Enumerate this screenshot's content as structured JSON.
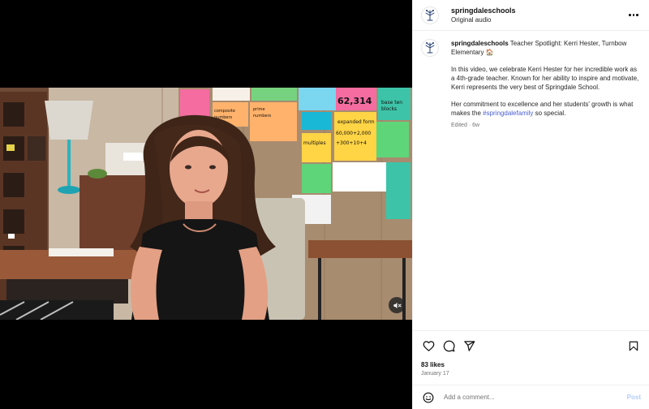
{
  "post": {
    "username": "springdaleschools",
    "audio": "Original audio",
    "caption_title": "Teacher Spotlight: Kerri Hester, Turnbow Elementary 🏠",
    "caption_p1": "In this video, we celebrate Kerri Hester for her incredible work as a 4th-grade teacher. Known for her ability to inspire and motivate, Kerri represents the very best of Springdale School.",
    "caption_p2_before": "Her commitment to excellence and her students' growth is what makes the ",
    "hashtag": "#springdalefamily",
    "caption_p2_after": " so special.",
    "edited": "Edited · 6w",
    "likes": "83 likes",
    "date": "January 17"
  },
  "comment": {
    "placeholder": "Add a comment...",
    "post_label": "Post"
  },
  "icons": {
    "more": "more-options-icon",
    "mute": "speaker-muted-icon",
    "like": "heart-icon",
    "comment": "comment-icon",
    "share": "share-icon",
    "save": "bookmark-icon",
    "emoji": "emoji-icon"
  },
  "colors": {
    "link": "#4a5fd0",
    "post_button": "#b3cdfa",
    "muted_text": "#737373"
  },
  "video": {
    "classroom_chart_labels": [
      "62,314",
      "expanded form",
      "60,000+2,000+300+10+4",
      "multiples",
      "composite numbers",
      "prime numbers",
      "base ten blocks"
    ]
  }
}
